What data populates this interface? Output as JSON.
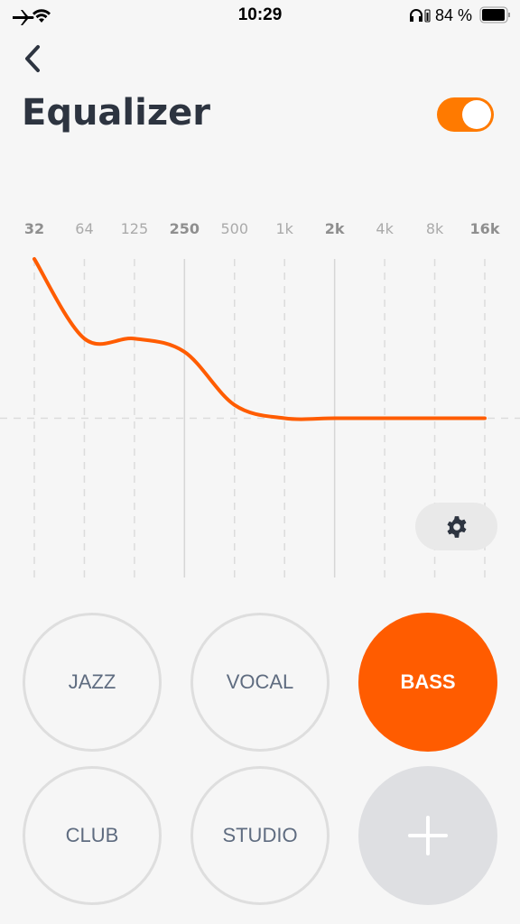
{
  "status": {
    "time": "10:29",
    "battery": "84 %",
    "icons": [
      "airplane-icon",
      "wifi-icon",
      "headphones-icon",
      "battery-icon"
    ]
  },
  "header": {
    "back_icon": "chevron-left-icon",
    "title": "Equalizer",
    "toggle_on": true
  },
  "colors": {
    "accent": "#ff5c00",
    "toggle": "#ff7a00"
  },
  "chart_data": {
    "type": "line",
    "categories": [
      "32",
      "64",
      "125",
      "250",
      "500",
      "1k",
      "2k",
      "4k",
      "8k",
      "16k"
    ],
    "bold_categories": [
      "32",
      "250",
      "2k",
      "16k"
    ],
    "values": [
      12,
      6,
      6,
      5,
      1,
      0,
      0,
      0,
      0,
      0
    ],
    "ylim": [
      -12,
      12
    ],
    "grid": true
  },
  "settings_icon": "gear-icon",
  "presets": [
    {
      "label": "JAZZ"
    },
    {
      "label": "VOCAL"
    },
    {
      "label": "BASS",
      "active": true
    },
    {
      "label": "CLUB"
    },
    {
      "label": "STUDIO"
    }
  ],
  "add_icon": "plus-icon"
}
